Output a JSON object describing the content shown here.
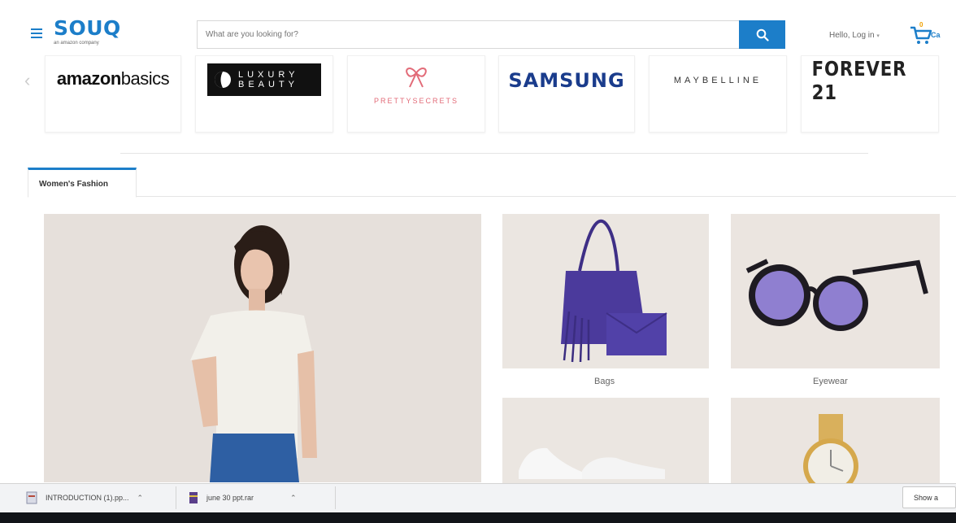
{
  "header": {
    "logo": "SOUQ",
    "logo_sub": "an amazon company",
    "search_placeholder": "What are you looking for?",
    "hello": "Hello, Log in",
    "cart_count": "0",
    "cart_label": "Ca"
  },
  "brands": {
    "amazon_prefix": "amazon",
    "amazon_suffix": "basics",
    "luxury_line1": "LUXURY",
    "luxury_line2": "BEAUTY",
    "pretty": "PRETTYSECRETS",
    "samsung": "SAMSUNG",
    "maybelline": "MAYBELLINE",
    "forever": "FOREVER 21"
  },
  "tabs": {
    "active": "Women's Fashion"
  },
  "tiles": {
    "bags": "Bags",
    "eyewear": "Eyewear"
  },
  "downloads": {
    "item1": "INTRODUCTION (1).pp...",
    "item2": "june 30 ppt.rar",
    "show_all": "Show a"
  },
  "colors": {
    "brand": "#1c7ec9",
    "bag": "#4b3a9c",
    "lens": "#8f7fd0"
  }
}
